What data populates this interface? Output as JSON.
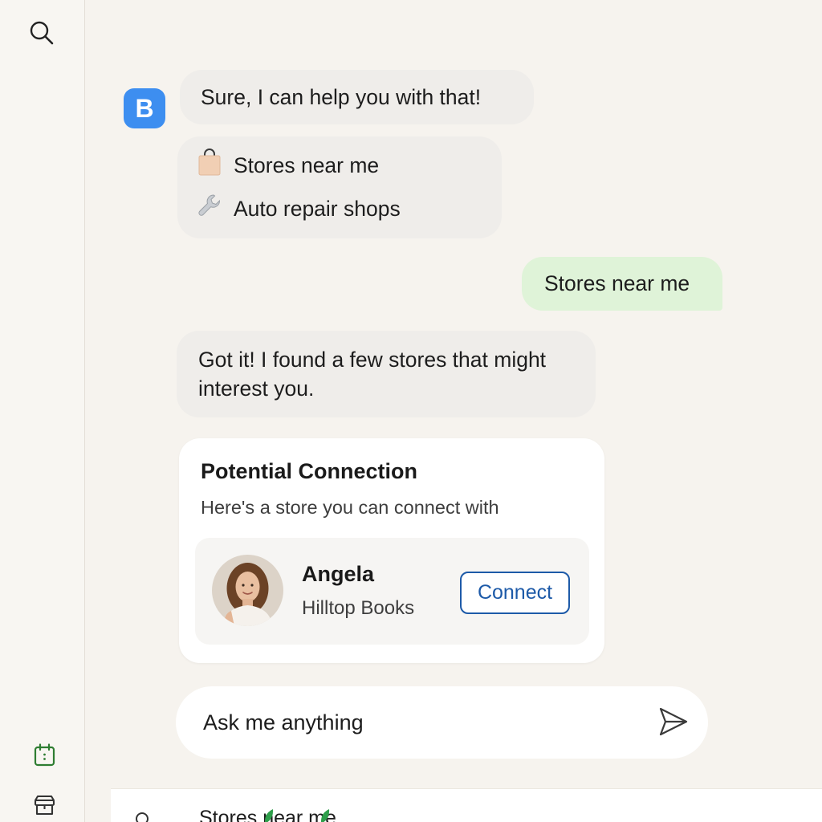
{
  "sidebar": {
    "icons": [
      "search-icon",
      "calendar-icon",
      "store-icon"
    ]
  },
  "colors": {
    "bot_avatar": "#3d8ef0",
    "bot_bubble": "#efedea",
    "user_bubble": "#dff3d8",
    "connect_accent": "#1d5aa8",
    "sidebar_icon_green": "#2e7d32"
  },
  "chat": {
    "bot_avatar_letter": "B",
    "greeting": "Sure, I can help you with that!",
    "options": [
      {
        "icon": "shopping-bag-icon",
        "label": "Stores near me"
      },
      {
        "icon": "wrench-icon",
        "label": "Auto repair shops"
      }
    ],
    "user_reply": "Stores near me",
    "bot_reply": "Got it! I found a few stores that might interest you."
  },
  "card": {
    "title": "Potential Connection",
    "subtitle": "Here's a store you can connect with",
    "contact": {
      "name": "Angela",
      "store": "Hilltop Books",
      "button_label": "Connect"
    }
  },
  "composer": {
    "placeholder": "Ask me anything",
    "send_icon": "send-icon"
  },
  "bottom_bar": {
    "text": "Stores near me",
    "icon": "search-icon"
  }
}
